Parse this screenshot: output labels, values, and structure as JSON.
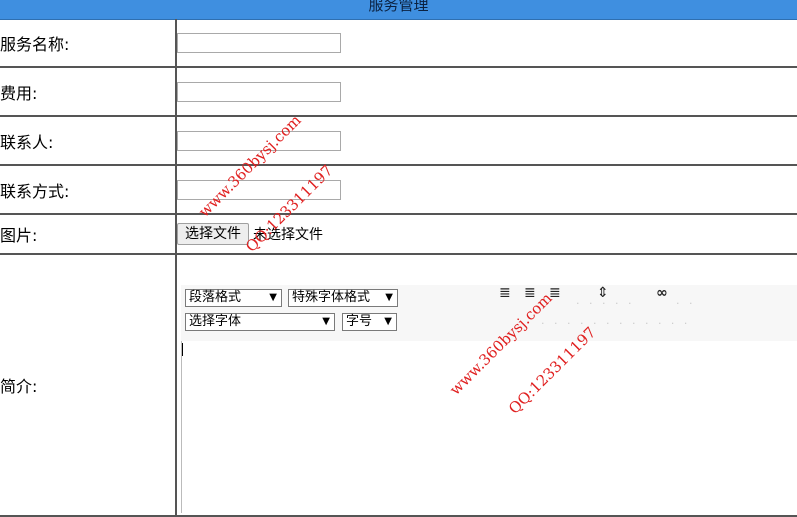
{
  "header": {
    "title": "服务管理"
  },
  "form": {
    "service_name_label": "服务名称:",
    "fee_label": "费用:",
    "contact_label": "联系人:",
    "contact_method_label": "联系方式:",
    "image_label": "图片:",
    "intro_label": "简介:",
    "file_button": "选择文件",
    "file_status": "未选择文件"
  },
  "toolbar": {
    "paragraph_format": "段落格式",
    "special_font_format": "特殊字体格式",
    "font_select": "选择字体",
    "font_size": "字号"
  },
  "watermarks": {
    "site": "www.360bysj.com",
    "qq": "QQ:123311197"
  },
  "colors": {
    "header_bg": "#3f8fe0",
    "watermark": "#e02020"
  }
}
